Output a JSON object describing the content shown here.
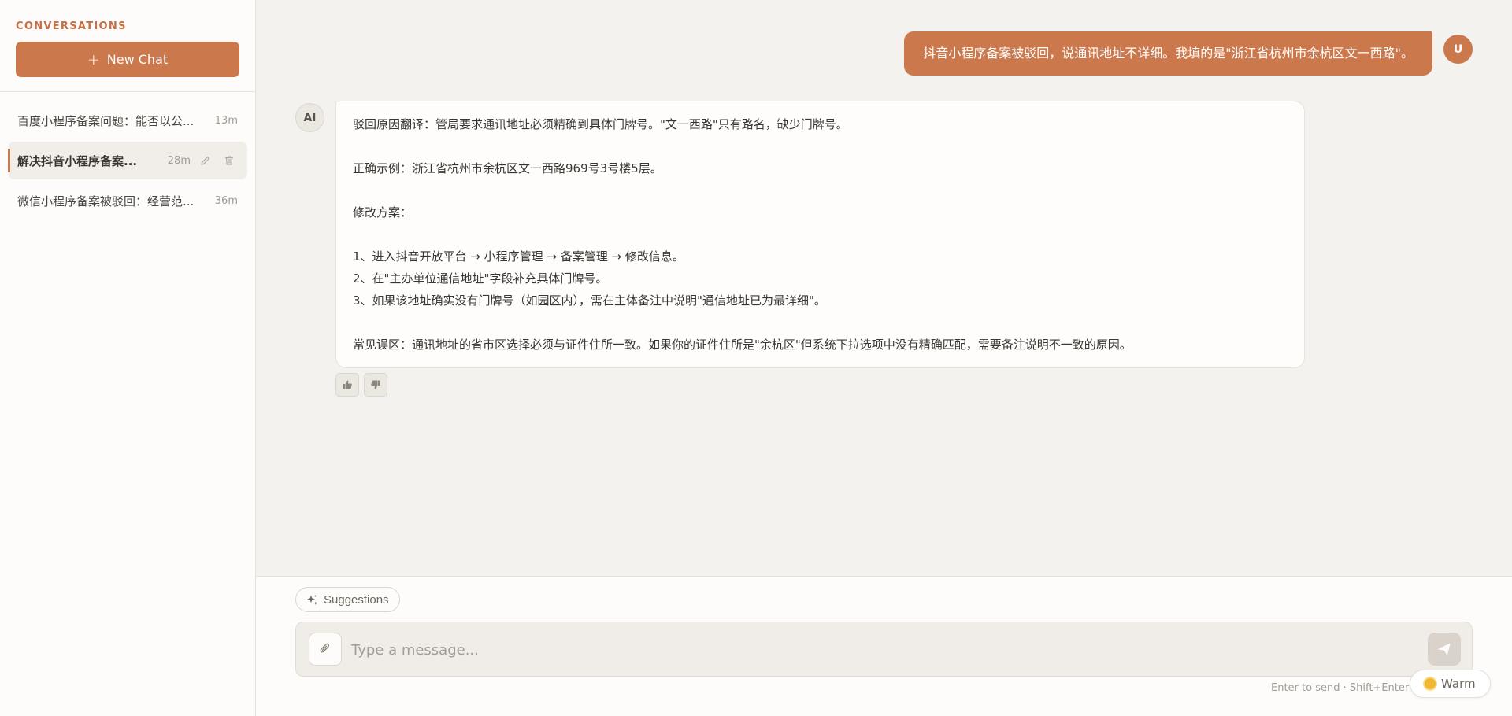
{
  "sidebar": {
    "title": "CONVERSATIONS",
    "new_chat_label": "New Chat",
    "conversations": [
      {
        "title": "百度小程序备案问题：能否以公...",
        "time": "13m",
        "active": false
      },
      {
        "title": "解决抖音小程序备案...",
        "time": "28m",
        "active": true
      },
      {
        "title": "微信小程序备案被驳回：经营范...",
        "time": "36m",
        "active": false
      }
    ]
  },
  "chat": {
    "user_avatar": "U",
    "ai_avatar": "AI",
    "user_message": "抖音小程序备案被驳回，说通讯地址不详细。我填的是\"浙江省杭州市余杭区文一西路\"。",
    "ai_message": {
      "line_1": "驳回原因翻译：管局要求通讯地址必须精确到具体门牌号。\"文一西路\"只有路名，缺少门牌号。",
      "line_2": "正确示例：浙江省杭州市余杭区文一西路969号3号楼5层。",
      "line_3": "修改方案：",
      "step_1": "1、进入抖音开放平台 → 小程序管理 → 备案管理 → 修改信息。",
      "step_2": "2、在\"主办单位通信地址\"字段补充具体门牌号。",
      "step_3": "3、如果该地址确实没有门牌号（如园区内），需在主体备注中说明\"通信地址已为最详细\"。",
      "line_4": "常见误区：通讯地址的省市区选择必须与证件住所一致。如果你的证件住所是\"余杭区\"但系统下拉选项中没有精确匹配，需要备注说明不一致的原因。"
    }
  },
  "composer": {
    "suggestions_label": "Suggestions",
    "placeholder": "Type a message...",
    "hint": "Enter to send · Shift+Enter for new line",
    "theme_label": "Warm"
  },
  "colors": {
    "accent": "#cb784d",
    "sidebar_title": "#c66f45",
    "background": "#f4f2ef"
  },
  "icons": {
    "new_chat": "plus-icon",
    "edit": "pencil-icon",
    "delete": "trash-icon",
    "like": "thumbs-up-icon",
    "dislike": "thumbs-down-icon",
    "suggestions": "sparkle-icon",
    "attach": "paperclip-icon",
    "send": "send-icon",
    "theme": "sun-icon"
  }
}
